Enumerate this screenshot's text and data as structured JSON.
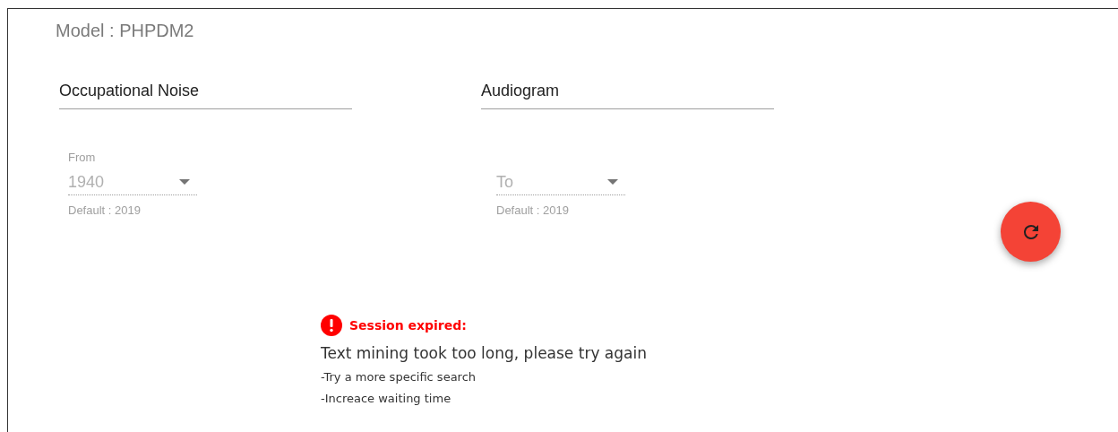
{
  "model_title": "Model : PHPDM2",
  "text_fields": [
    {
      "value": "Occupational Noise"
    },
    {
      "value": "Audiogram"
    }
  ],
  "selects": [
    {
      "label": "From",
      "value": "1940",
      "helper": "Default : 2019"
    },
    {
      "placeholder": "To",
      "helper": "Default : 2019"
    }
  ],
  "error": {
    "title": "Session expired:",
    "message": "Text mining took too long, please try again",
    "tips": [
      "-Try a more specific search",
      "-Increace waiting time"
    ]
  }
}
